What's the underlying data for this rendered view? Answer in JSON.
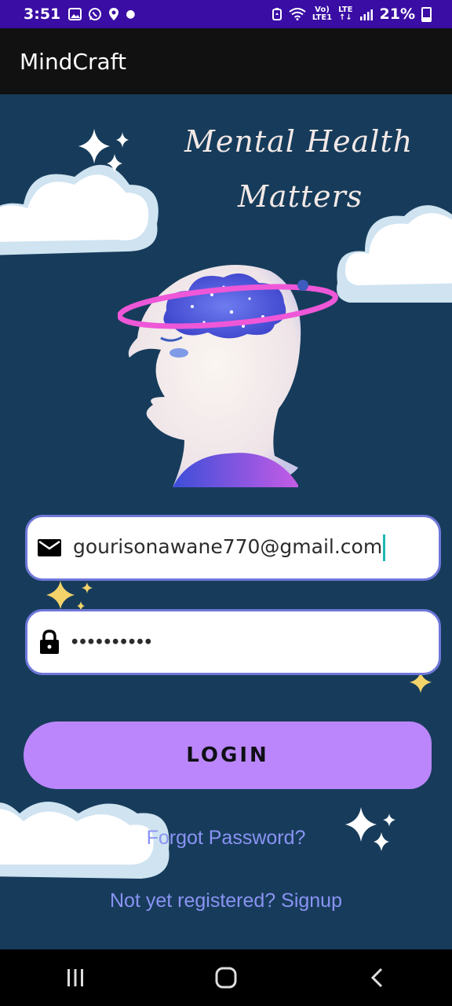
{
  "status_bar": {
    "time": "3:51",
    "battery": "21%",
    "network_top": "Vo)",
    "network_bottom": "LTE1",
    "lte_label": "LTE"
  },
  "app_bar": {
    "title": "MindCraft"
  },
  "hero": {
    "headline_line1": "Mental Health",
    "headline_line2": "Matters"
  },
  "form": {
    "email_value": "gourisonawane770@gmail.com",
    "password_mask": "••••••••••",
    "login_label": "LOGIN",
    "forgot_label": "Forgot Password?",
    "signup_label": "Not yet registered? Signup"
  },
  "colors": {
    "background": "#173c5b",
    "status_bar": "#3a0da4",
    "button": "#bb86fb",
    "link": "#8a93f4",
    "field_border": "#6f77d9"
  },
  "icons": {
    "email": "email-icon",
    "password": "lock-icon",
    "recent_apps": "recent-apps-icon",
    "home": "home-icon",
    "back": "back-icon"
  }
}
